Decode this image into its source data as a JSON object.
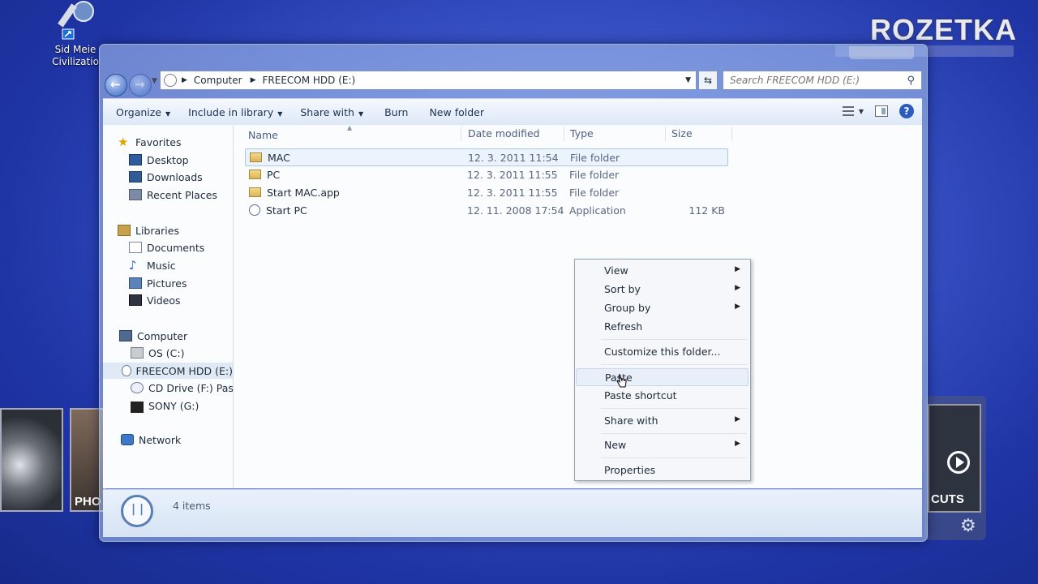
{
  "watermark": "ROZETKA",
  "desktop_icon": {
    "label_line1": "Sid Meie",
    "label_line2": "Civilizatio"
  },
  "media_strip": {
    "left_tile_label": "PHO",
    "right_tile_label": "CUTS"
  },
  "explorer": {
    "breadcrumb": [
      "Computer",
      "FREECOM HDD (E:)"
    ],
    "search_placeholder": "Search FREECOM HDD (E:)",
    "toolbar": {
      "organize": "Organize",
      "include_in_library": "Include in library",
      "share_with": "Share with",
      "burn": "Burn",
      "new_folder": "New folder"
    },
    "sidebar": {
      "favorites": {
        "label": "Favorites",
        "items": [
          "Desktop",
          "Downloads",
          "Recent Places"
        ]
      },
      "libraries": {
        "label": "Libraries",
        "items": [
          "Documents",
          "Music",
          "Pictures",
          "Videos"
        ]
      },
      "computer": {
        "label": "Computer",
        "items": [
          "OS (C:)",
          "FREECOM HDD (E:)",
          "CD Drive (F:) Passwc",
          "SONY (G:)"
        ]
      },
      "network": {
        "label": "Network"
      }
    },
    "columns": {
      "name": "Name",
      "date_modified": "Date modified",
      "type": "Type",
      "size": "Size"
    },
    "files": [
      {
        "name": "MAC",
        "date": "12. 3. 2011 11:54",
        "type": "File folder",
        "size": "",
        "icon": "folder-icon"
      },
      {
        "name": "PC",
        "date": "12. 3. 2011 11:55",
        "type": "File folder",
        "size": "",
        "icon": "folder-icon"
      },
      {
        "name": "Start MAC.app",
        "date": "12. 3. 2011 11:55",
        "type": "File folder",
        "size": "",
        "icon": "folder-icon"
      },
      {
        "name": "Start PC",
        "date": "12. 11. 2008 17:54",
        "type": "Application",
        "size": "112 KB",
        "icon": "app-icon"
      }
    ],
    "status": {
      "item_count": "4 items"
    }
  },
  "context_menu": {
    "items": [
      {
        "label": "View",
        "submenu": true
      },
      {
        "label": "Sort by",
        "submenu": true
      },
      {
        "label": "Group by",
        "submenu": true
      },
      {
        "label": "Refresh",
        "submenu": false
      },
      {
        "label": "Customize this folder...",
        "submenu": false
      },
      {
        "label": "Paste",
        "submenu": false
      },
      {
        "label": "Paste shortcut",
        "submenu": false
      },
      {
        "label": "Share with",
        "submenu": true
      },
      {
        "label": "New",
        "submenu": true
      },
      {
        "label": "Properties",
        "submenu": false
      }
    ]
  },
  "colors": {
    "desktop_bg": "#2a40b4",
    "selection": "#dfe9f5",
    "help_blue": "#2b5cbf"
  }
}
